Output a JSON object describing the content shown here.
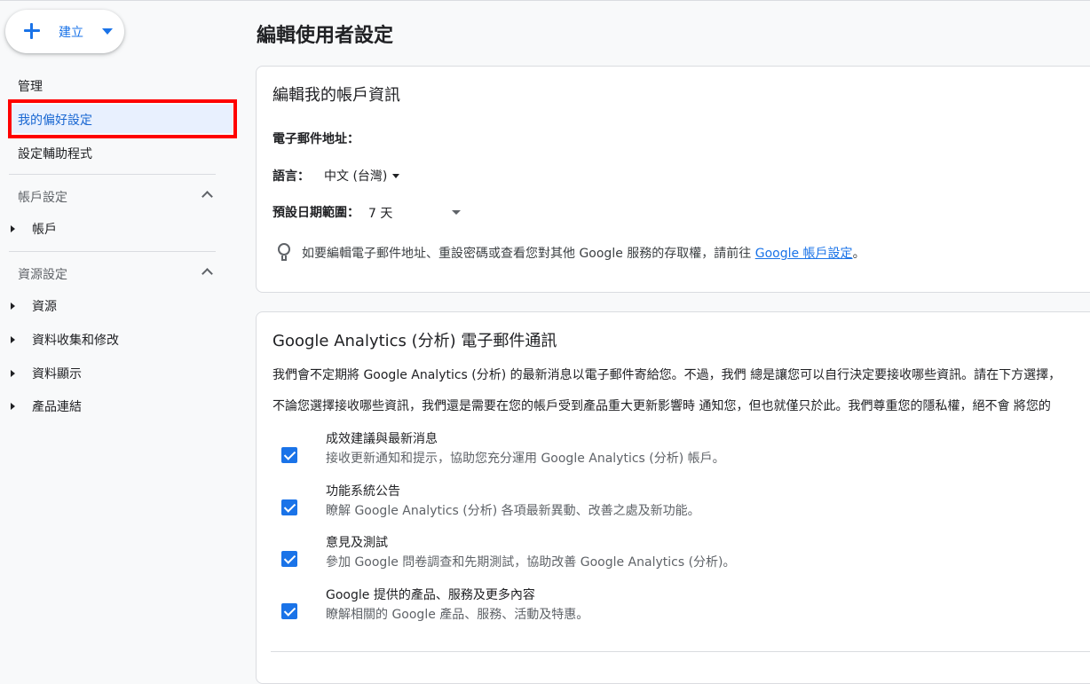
{
  "create": {
    "label": "建立"
  },
  "sidebar": {
    "admin": "管理",
    "my_prefs": "我的偏好設定",
    "a11y": "設定輔助程式",
    "account_section": "帳戶設定",
    "account_item": "帳戶",
    "property_section": "資源設定",
    "property_items": [
      "資源",
      "資料收集和修改",
      "資料顯示",
      "產品連結"
    ]
  },
  "page": {
    "title": "編輯使用者設定"
  },
  "account_card": {
    "title": "編輯我的帳戶資訊",
    "email_label": "電子郵件地址：",
    "language_label": "語言：",
    "language_value": "中文 (台灣)",
    "date_range_label": "預設日期範圍：",
    "date_range_value": "7 天",
    "hint_text": "如要編輯電子郵件地址、重設密碼或查看您對其他 Google 服務的存取權，請前往",
    "hint_link": "Google 帳戶設定",
    "hint_end": "。"
  },
  "email_card": {
    "title": "Google Analytics (分析) 電子郵件通訊",
    "para1": "我們會不定期將 Google Analytics (分析) 的最新消息以電子郵件寄給您。不過，我們 總是讓您可以自行決定要接收哪些資訊。請在下方選擇，",
    "para2": "不論您選擇接收哪些資訊，我們還是需要在您的帳戶受到產品重大更新影響時 通知您，但也就僅只於此。我們尊重您的隱私權，絕不會 將您的",
    "options": [
      {
        "title": "成效建議與最新消息",
        "desc": "接收更新通知和提示，協助您充分運用 Google Analytics (分析) 帳戶。",
        "checked": true
      },
      {
        "title": "功能系統公告",
        "desc": "瞭解 Google Analytics (分析) 各項最新異動、改善之處及新功能。",
        "checked": true
      },
      {
        "title": "意見及測試",
        "desc": "參加 Google 問卷調查和先期測試，協助改善 Google Analytics (分析)。",
        "checked": true
      },
      {
        "title": "Google 提供的產品、服務及更多內容",
        "desc": "瞭解相關的 Google 產品、服務、活動及特惠。",
        "checked": true
      }
    ]
  },
  "colors": {
    "accent": "#1a73e8",
    "highlight_box": "#ff0000",
    "active_bg": "#e8f0fe"
  }
}
